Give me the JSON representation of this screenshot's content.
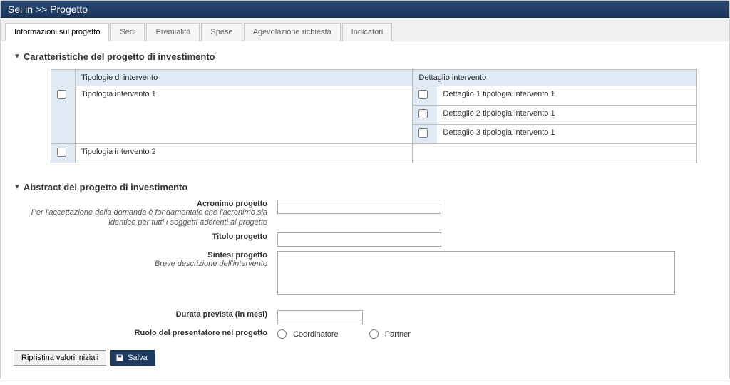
{
  "breadcrumb": "Sei in >> Progetto",
  "tabs": {
    "info": "Informazioni sul progetto",
    "sedi": "Sedi",
    "premialita": "Premialità",
    "spese": "Spese",
    "agevolazione": "Agevolazione richiesta",
    "indicatori": "Indicatori"
  },
  "sections": {
    "caratteristiche": "Caratteristiche del progetto di investimento",
    "abstract": "Abstract del progetto di investimento"
  },
  "char_table": {
    "headers": {
      "tipologie": "Tipologie di intervento",
      "dettaglio": "Dettaglio intervento"
    },
    "rows": [
      {
        "tipologia": "Tipologia intervento 1",
        "dettagli": [
          "Dettaglio 1 tipologia intervento 1",
          "Dettaglio 2 tipologia intervento 1",
          "Dettaglio 3 tipologia intervento 1"
        ]
      },
      {
        "tipologia": "Tipologia intervento 2",
        "dettagli": []
      }
    ]
  },
  "form": {
    "acronimo": {
      "label": "Acronimo progetto",
      "hint": "Per l'accettazione della domanda è fondamentale che l'acronimo sia identico per tutti i soggetti aderenti al progetto",
      "value": ""
    },
    "titolo": {
      "label": "Titolo progetto",
      "value": ""
    },
    "sintesi": {
      "label": "Sintesi progetto",
      "hint": "Breve descrizione dell'intervento",
      "value": ""
    },
    "durata": {
      "label": "Durata prevista (in mesi)",
      "value": ""
    },
    "ruolo": {
      "label": "Ruolo del presentatore nel progetto",
      "options": {
        "coord": "Coordinatore",
        "partner": "Partner"
      }
    }
  },
  "actions": {
    "reset": "Ripristina valori iniziali",
    "save": "Salva"
  }
}
